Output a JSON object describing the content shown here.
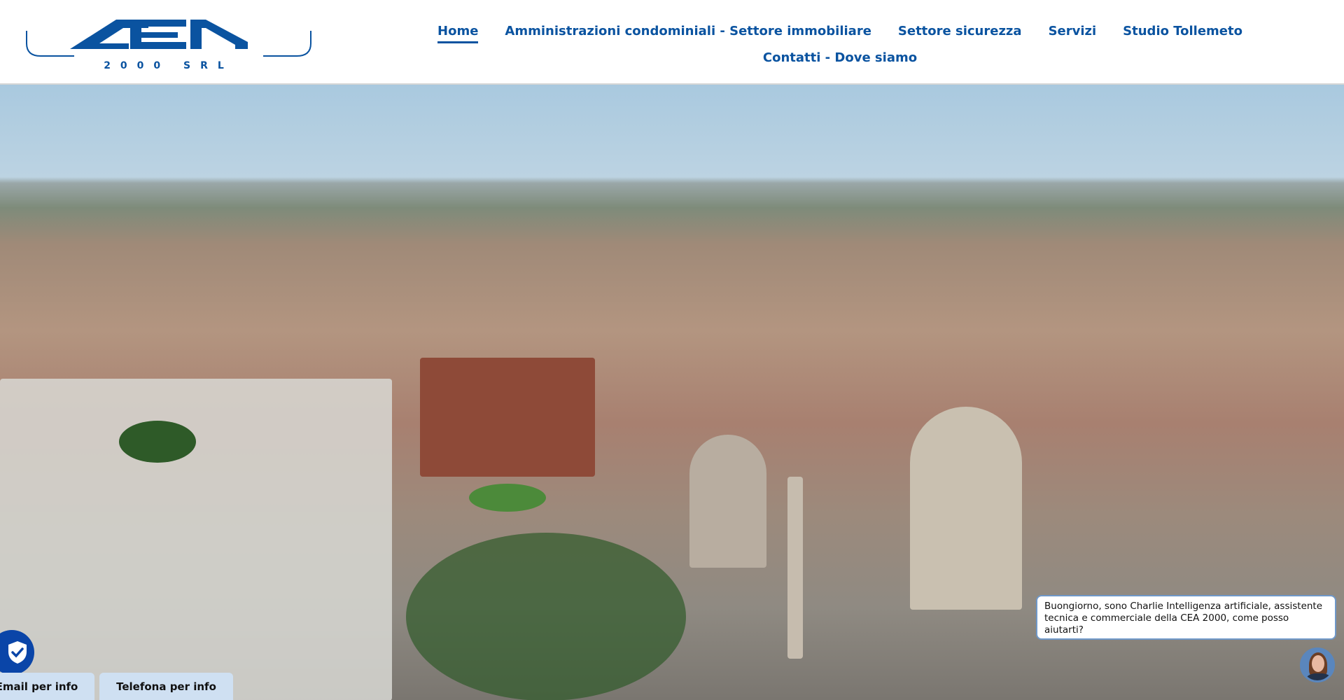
{
  "logo": {
    "text": "CEA",
    "subtext": "2000 SRL"
  },
  "nav": {
    "items": [
      {
        "label": "Home",
        "active": true
      },
      {
        "label": "Amministrazioni condominiali - Settore immobiliare"
      },
      {
        "label": "Settore sicurezza"
      },
      {
        "label": "Servizi"
      },
      {
        "label": "Studio Tollemeto"
      },
      {
        "label": "Contatti - Dove siamo"
      }
    ]
  },
  "chat": {
    "message": "Buongiorno, sono Charlie Intelligenza artificiale, assistente tecnica e commerciale della CEA 2000, come posso aiutarti?"
  },
  "buttons": {
    "email": "Email per info",
    "phone": "Telefona per info"
  },
  "colors": {
    "brand": "#0a53a0",
    "button_bg": "#cfe0f2"
  }
}
